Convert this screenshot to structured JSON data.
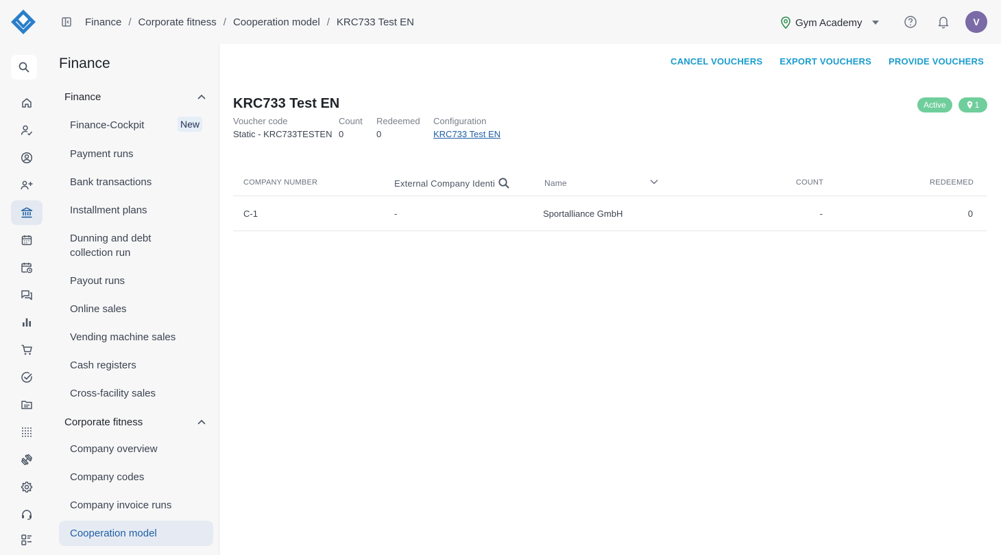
{
  "breadcrumb": [
    "Finance",
    "Corporate fitness",
    "Cooperation model",
    "KRC733 Test EN"
  ],
  "header": {
    "gym_name": "Gym Academy",
    "avatar_initial": "V"
  },
  "subnav": {
    "title": "Finance",
    "groups": [
      {
        "label": "Finance",
        "items": [
          "Finance-Cockpit",
          "Payment runs",
          "Bank transactions",
          "Installment plans",
          "Dunning and debt collection run",
          "Payout runs",
          "Online sales",
          "Vending machine sales",
          "Cash registers",
          "Cross-facility sales"
        ]
      },
      {
        "label": "Corporate fitness",
        "items": [
          "Company overview",
          "Company codes",
          "Company invoice runs",
          "Cooperation model"
        ]
      }
    ],
    "new_badge": "New"
  },
  "actions": [
    "CANCEL VOUCHERS",
    "EXPORT VOUCHERS",
    "PROVIDE VOUCHERS"
  ],
  "detail": {
    "title": "KRC733 Test EN",
    "status": "Active",
    "location_count": "1",
    "fields": [
      {
        "label": "Voucher code",
        "value": "Static - KRC733TESTEN"
      },
      {
        "label": "Count",
        "value": "0"
      },
      {
        "label": "Redeemed",
        "value": "0"
      },
      {
        "label": "Configuration",
        "value": "KRC733 Test EN"
      }
    ]
  },
  "table": {
    "headers": [
      "COMPANY NUMBER",
      "External Company Identi",
      "Name",
      "COUNT",
      "REDEEMED"
    ],
    "rows": [
      [
        "C-1",
        "-",
        "Sportalliance GmbH",
        "-",
        "0"
      ]
    ]
  },
  "colors": {
    "accent": "#1f5fa5",
    "link": "#1a9ccc",
    "status": "#6fce9b",
    "avatar": "#7a6aa6"
  }
}
